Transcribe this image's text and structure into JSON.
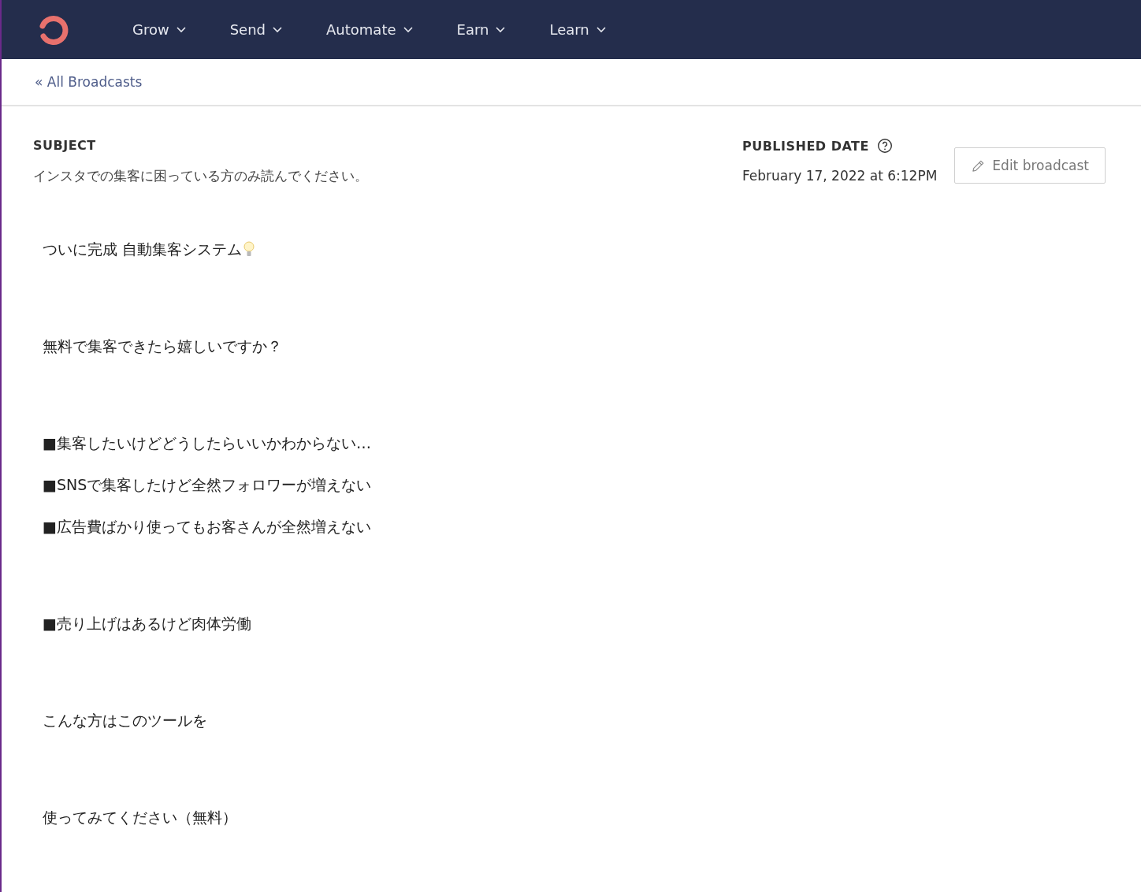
{
  "nav": {
    "items": [
      {
        "label": "Grow"
      },
      {
        "label": "Send"
      },
      {
        "label": "Automate"
      },
      {
        "label": "Earn"
      },
      {
        "label": "Learn"
      }
    ]
  },
  "back_link": "« All Broadcasts",
  "subject": {
    "label": "SUBJECT",
    "value": "インスタでの集客に困っている方のみ読んでください。"
  },
  "published": {
    "label": "PUBLISHED DATE",
    "value": "February 17, 2022 at 6:12PM"
  },
  "edit_button": "Edit broadcast",
  "body": [
    [
      "ついに完成 自動集客システム"
    ],
    [
      "無料で集客できたら嬉しいですか？"
    ],
    [
      "■集客したいけどどうしたらいいかわからない…",
      "■SNSで集客したけど全然フォロワーが増えない",
      "■広告費ばかり使ってもお客さんが全然増えない"
    ],
    [
      "■売り上げはあるけど肉体労働"
    ],
    [
      "こんな方はこのツールを"
    ],
    [
      "使ってみてください（無料）"
    ]
  ]
}
